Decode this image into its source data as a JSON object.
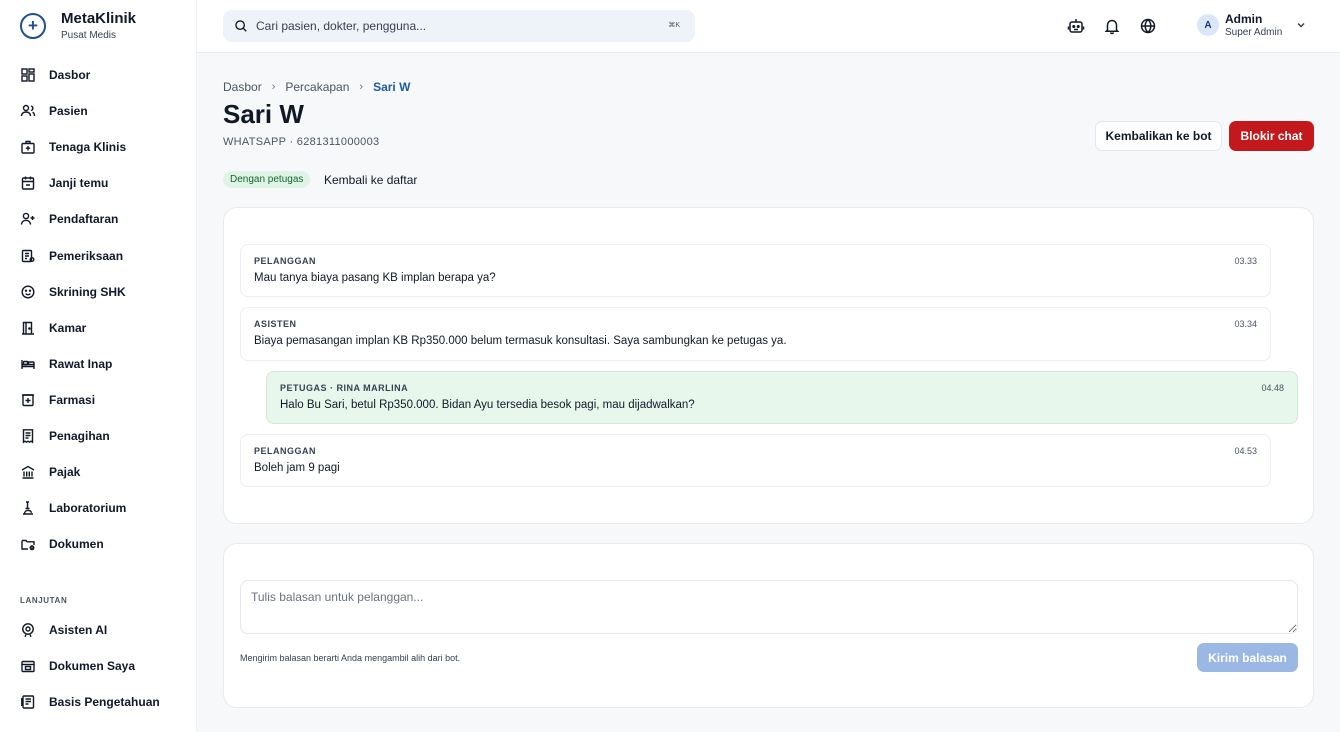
{
  "brand": {
    "name": "MetaKlinik",
    "subtitle": "Pusat Medis"
  },
  "sidebar": {
    "items": [
      {
        "label": "Dasbor",
        "icon": "dashboard-icon"
      },
      {
        "label": "Pasien",
        "icon": "users-icon"
      },
      {
        "label": "Tenaga Klinis",
        "icon": "medical-bag-icon"
      },
      {
        "label": "Janji temu",
        "icon": "calendar-icon"
      },
      {
        "label": "Pendaftaran",
        "icon": "user-plus-icon"
      },
      {
        "label": "Pemeriksaan",
        "icon": "clipboard-icon"
      },
      {
        "label": "Skrining SHK",
        "icon": "baby-face-icon"
      },
      {
        "label": "Kamar",
        "icon": "door-icon"
      },
      {
        "label": "Rawat Inap",
        "icon": "bed-icon"
      },
      {
        "label": "Farmasi",
        "icon": "pharmacy-icon"
      },
      {
        "label": "Penagihan",
        "icon": "receipt-icon"
      },
      {
        "label": "Pajak",
        "icon": "bank-icon"
      },
      {
        "label": "Laboratorium",
        "icon": "microscope-icon"
      },
      {
        "label": "Dokumen",
        "icon": "folder-icon"
      }
    ],
    "section_label": "LANJUTAN",
    "advanced_items": [
      {
        "label": "Asisten AI",
        "icon": "ai-icon"
      },
      {
        "label": "Dokumen Saya",
        "icon": "my-documents-icon"
      },
      {
        "label": "Basis Pengetahuan",
        "icon": "knowledge-base-icon"
      }
    ]
  },
  "topbar": {
    "search_placeholder": "Cari pasien, dokter, pengguna...",
    "shortcut": "⌘K",
    "user": {
      "initial": "A",
      "name": "Admin",
      "role": "Super Admin"
    }
  },
  "breadcrumb": {
    "items": [
      "Dasbor",
      "Percakapan"
    ],
    "current": "Sari W"
  },
  "page": {
    "title": "Sari W",
    "subtitle": "WHATSAPP · 6281311000003",
    "status_badge": "Dengan petugas",
    "back_link": "Kembali ke daftar"
  },
  "actions": {
    "return_to_bot": "Kembalikan ke bot",
    "block_chat": "Blokir chat"
  },
  "messages": [
    {
      "sender": "PELANGGAN",
      "time": "03.33",
      "text": "Mau tanya biaya pasang KB implan berapa ya?"
    },
    {
      "sender": "ASISTEN",
      "time": "03.34",
      "text": "Biaya pemasangan implan KB Rp350.000 belum termasuk konsultasi. Saya sambungkan ke petugas ya."
    },
    {
      "sender": "PETUGAS · RINA MARLINA",
      "time": "04.48",
      "text": "Halo Bu Sari, betul Rp350.000. Bidan Ayu tersedia besok pagi, mau dijadwalkan?"
    },
    {
      "sender": "PELANGGAN",
      "time": "04.53",
      "text": "Boleh jam 9 pagi"
    }
  ],
  "reply": {
    "placeholder": "Tulis balasan untuk pelanggan...",
    "hint": "Mengirim balasan berarti Anda mengambil alih dari bot.",
    "send_label": "Kirim balasan"
  },
  "colors": {
    "accent": "#1e5aa8",
    "danger": "#c4191c",
    "send_disabled": "#9bb8e4",
    "staff_bubble": "#e8f7ec",
    "badge_bg": "#dff4e6"
  }
}
